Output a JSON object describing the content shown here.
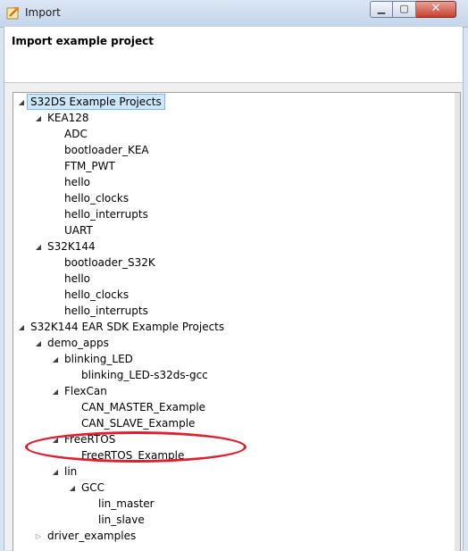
{
  "window": {
    "title": "Import"
  },
  "window_buttons": {
    "minimize": "▁",
    "maximize": "▢",
    "close": "✕"
  },
  "header": {
    "title": "Import example project"
  },
  "tree": {
    "items": [
      {
        "label": "S32DS Example Projects",
        "level": 0,
        "state": "expanded",
        "selected": true
      },
      {
        "label": "KEA128",
        "level": 1,
        "state": "expanded"
      },
      {
        "label": "ADC",
        "level": 2,
        "state": "leaf"
      },
      {
        "label": "bootloader_KEA",
        "level": 2,
        "state": "leaf"
      },
      {
        "label": "FTM_PWT",
        "level": 2,
        "state": "leaf"
      },
      {
        "label": "hello",
        "level": 2,
        "state": "leaf"
      },
      {
        "label": "hello_clocks",
        "level": 2,
        "state": "leaf"
      },
      {
        "label": "hello_interrupts",
        "level": 2,
        "state": "leaf"
      },
      {
        "label": "UART",
        "level": 2,
        "state": "leaf"
      },
      {
        "label": "S32K144",
        "level": 1,
        "state": "expanded"
      },
      {
        "label": "bootloader_S32K",
        "level": 2,
        "state": "leaf"
      },
      {
        "label": "hello",
        "level": 2,
        "state": "leaf"
      },
      {
        "label": "hello_clocks",
        "level": 2,
        "state": "leaf"
      },
      {
        "label": "hello_interrupts",
        "level": 2,
        "state": "leaf"
      },
      {
        "label": "S32K144 EAR SDK Example Projects",
        "level": 0,
        "state": "expanded"
      },
      {
        "label": "demo_apps",
        "level": 1,
        "state": "expanded"
      },
      {
        "label": "blinking_LED",
        "level": 2,
        "state": "expanded"
      },
      {
        "label": "blinking_LED-s32ds-gcc",
        "level": 3,
        "state": "leaf"
      },
      {
        "label": "FlexCan",
        "level": 2,
        "state": "expanded"
      },
      {
        "label": "CAN_MASTER_Example",
        "level": 3,
        "state": "leaf"
      },
      {
        "label": "CAN_SLAVE_Example",
        "level": 3,
        "state": "leaf"
      },
      {
        "label": "FreeRTOS",
        "level": 2,
        "state": "expanded"
      },
      {
        "label": "FreeRTOS_Example",
        "level": 3,
        "state": "leaf"
      },
      {
        "label": "lin",
        "level": 2,
        "state": "expanded"
      },
      {
        "label": "GCC",
        "level": 3,
        "state": "expanded"
      },
      {
        "label": "lin_master",
        "level": 4,
        "state": "leaf"
      },
      {
        "label": "lin_slave",
        "level": 4,
        "state": "leaf"
      },
      {
        "label": "driver_examples",
        "level": 1,
        "state": "collapsed"
      }
    ]
  },
  "colors": {
    "highlight_ellipse": "#e01e2e",
    "selection": "#cde8fb"
  }
}
